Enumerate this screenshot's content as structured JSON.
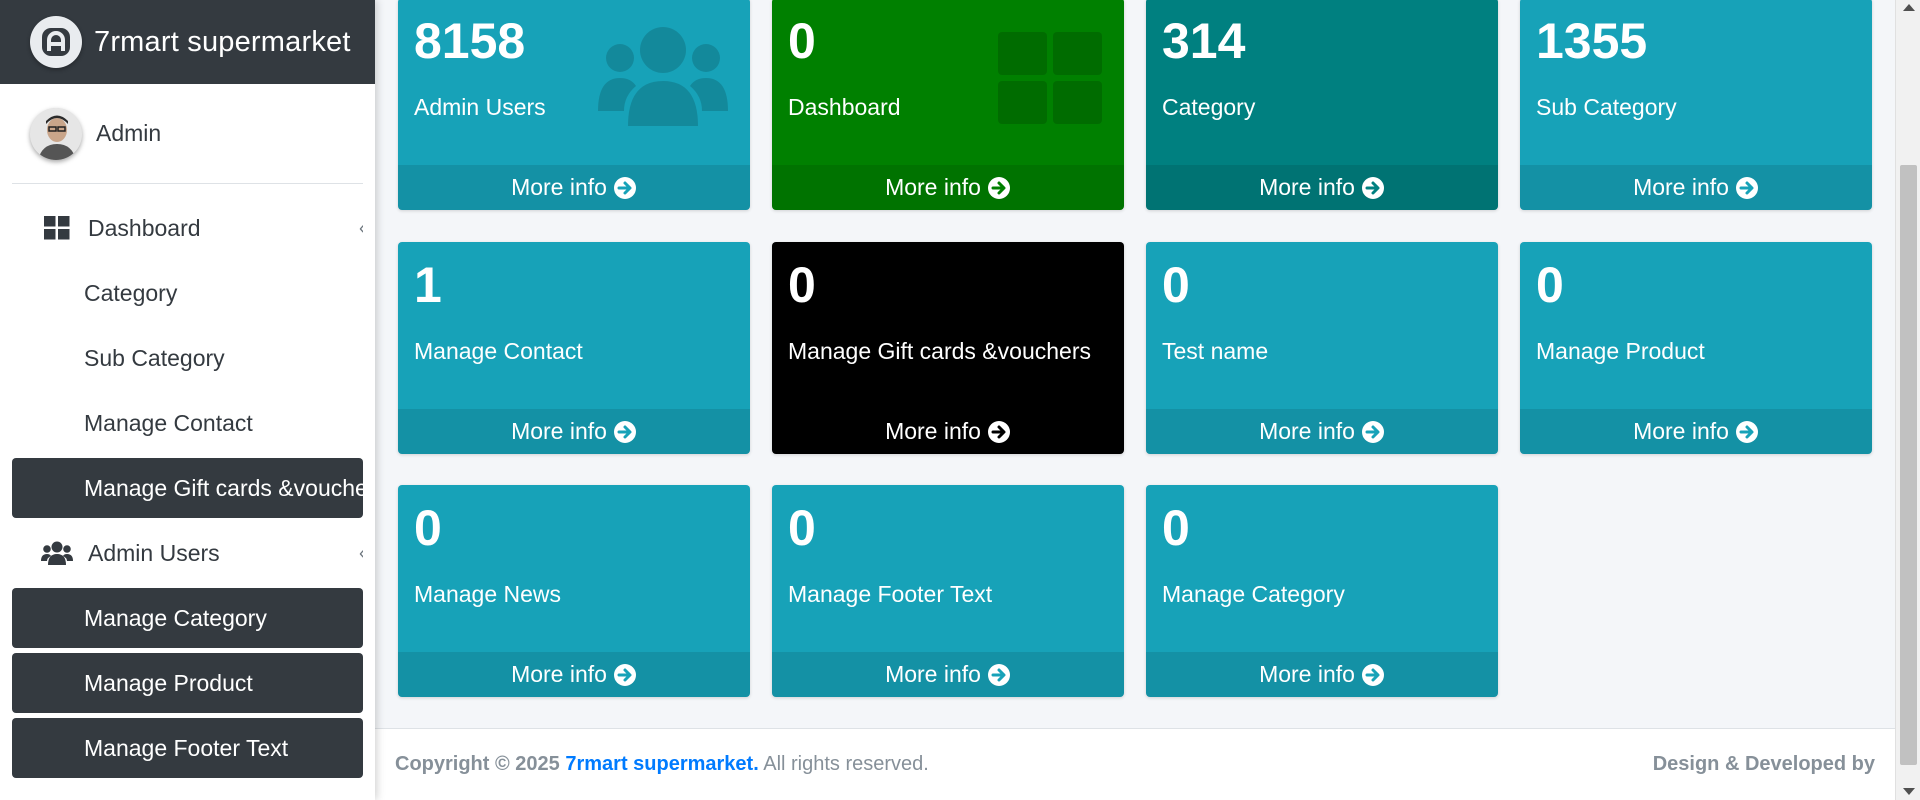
{
  "brand": {
    "name": "7rmart supermarket",
    "logo_icon": "logo-badge-icon"
  },
  "user": {
    "name": "Admin"
  },
  "sidebar": {
    "items": [
      {
        "label": "Dashboard",
        "icon": "grid-icon",
        "has_caret": true
      },
      {
        "label": "Category"
      },
      {
        "label": "Sub Category"
      },
      {
        "label": "Manage Contact"
      },
      {
        "label": "Manage Gift cards &vouchers",
        "active": true
      },
      {
        "label": "Admin Users",
        "icon": "users-icon",
        "has_caret": true
      },
      {
        "label": "Manage Category",
        "active": true
      },
      {
        "label": "Manage Product",
        "active": true
      },
      {
        "label": "Manage Footer Text",
        "active": true
      }
    ]
  },
  "cards": [
    {
      "count": "8158",
      "title": "Admin Users",
      "more": "More info",
      "color": "#17a2b8",
      "icon": "users-icon"
    },
    {
      "count": "0",
      "title": "Dashboard",
      "more": "More info",
      "color": "#008000",
      "icon": "grid-icon"
    },
    {
      "count": "314",
      "title": "Category",
      "more": "More info",
      "color": "#008080"
    },
    {
      "count": "1355",
      "title": "Sub Category",
      "more": "More info",
      "color": "#17a2b8"
    },
    {
      "count": "1",
      "title": "Manage Contact",
      "more": "More info",
      "color": "#17a2b8"
    },
    {
      "count": "0",
      "title": "Manage Gift cards &vouchers",
      "more": "More info",
      "color": "#000000"
    },
    {
      "count": "0",
      "title": "Test name",
      "more": "More info",
      "color": "#17a2b8"
    },
    {
      "count": "0",
      "title": "Manage Product",
      "more": "More info",
      "color": "#17a2b8"
    },
    {
      "count": "0",
      "title": "Manage News",
      "more": "More info",
      "color": "#17a2b8"
    },
    {
      "count": "0",
      "title": "Manage Footer Text",
      "more": "More info",
      "color": "#17a2b8"
    },
    {
      "count": "0",
      "title": "Manage Category",
      "more": "More info",
      "color": "#17a2b8"
    }
  ],
  "footer": {
    "copyright": "Copyright © 2025",
    "brand_link": "7rmart supermarket.",
    "rights": "All rights reserved.",
    "credit": "Design & Developed by"
  }
}
